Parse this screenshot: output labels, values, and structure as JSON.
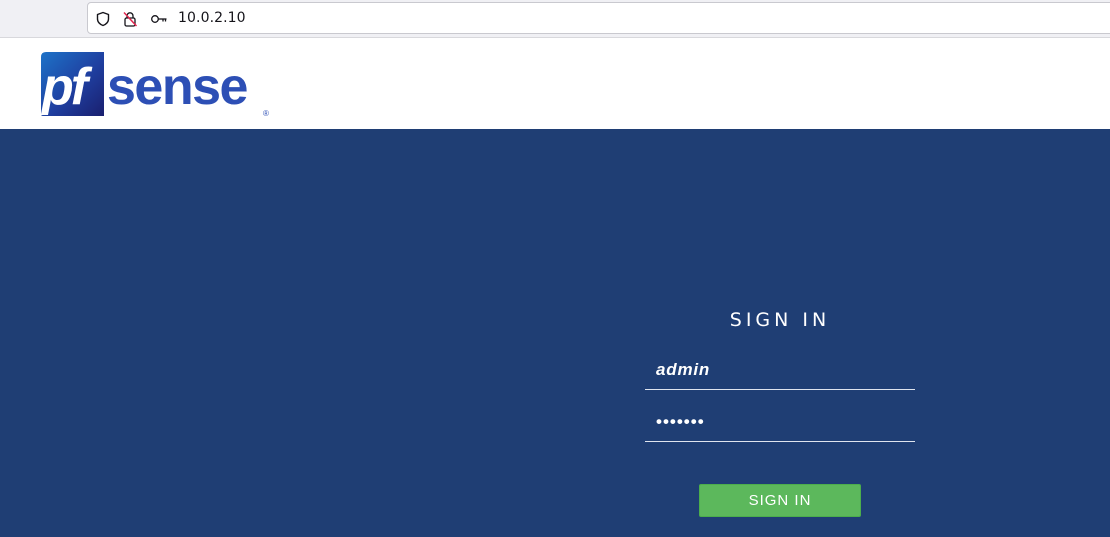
{
  "browser": {
    "url": "10.0.2.10",
    "icons": [
      "shield-icon",
      "insecure-lock-icon",
      "key-icon"
    ]
  },
  "header": {
    "logo_text_pf": "pf",
    "logo_text_sense": "sense",
    "logo_mark": "®"
  },
  "login": {
    "title": "SIGN IN",
    "username_value": "admin",
    "password_value": "•••••••",
    "button_label": "SIGN IN"
  },
  "colors": {
    "background": "#1f3e74",
    "button": "#5cb85c",
    "logo_blue": "#2d4fb5",
    "logo_square": "#1a2a7a"
  }
}
